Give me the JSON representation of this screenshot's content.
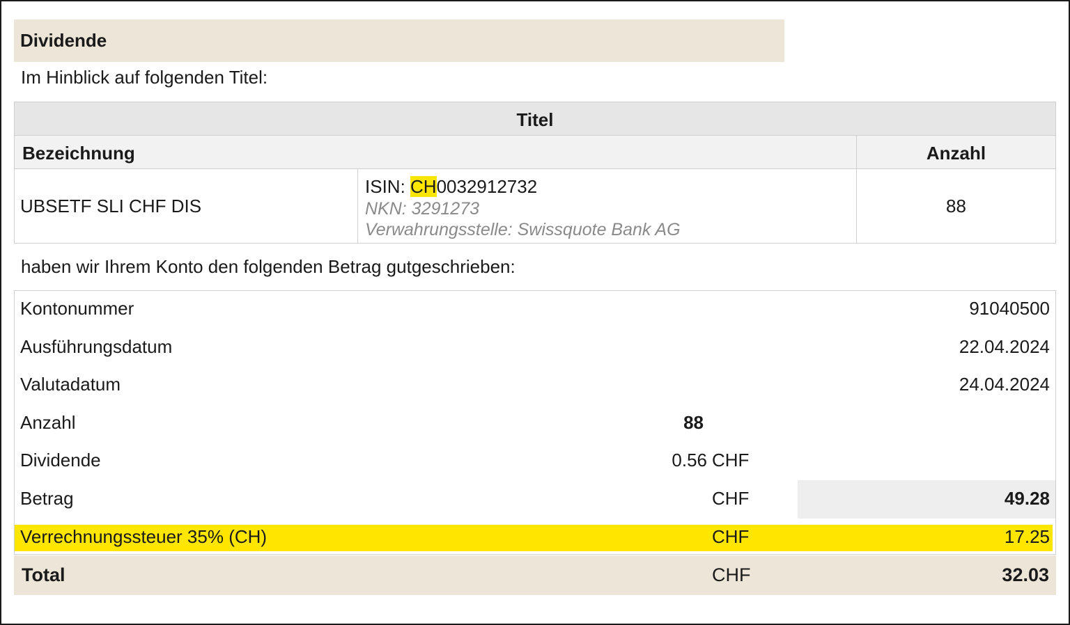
{
  "section_title": "Dividende",
  "intro_text": "Im Hinblick auf folgenden Titel:",
  "titel_table": {
    "header": "Titel",
    "col_bezeichnung": "Bezeichnung",
    "col_anzahl": "Anzahl",
    "row": {
      "name": "UBSETF SLI CHF DIS",
      "isin_label": "ISIN: ",
      "isin_country": "CH",
      "isin_number": "0032912732",
      "nkn": "NKN: 3291273",
      "verwahrungsstelle": "Verwahrungsstelle: Swissquote Bank AG",
      "anzahl": "88"
    }
  },
  "credit_text": "haben wir Ihrem Konto den folgenden Betrag gutgeschrieben:",
  "details": {
    "kontonummer": {
      "label": "Kontonummer",
      "value": "91040500"
    },
    "ausfuehrungsdatum": {
      "label": "Ausführungsdatum",
      "value": "22.04.2024"
    },
    "valutadatum": {
      "label": "Valutadatum",
      "value": "24.04.2024"
    },
    "anzahl": {
      "label": "Anzahl",
      "qty": "88"
    },
    "dividende": {
      "label": "Dividende",
      "qty": "0.56",
      "currency": "CHF"
    },
    "betrag": {
      "label": "Betrag",
      "currency": "CHF",
      "value": "49.28"
    },
    "verrechnungssteuer": {
      "label": "Verrechnungssteuer 35% (CH)",
      "currency": "CHF",
      "value": "17.25"
    },
    "total": {
      "label": "Total",
      "currency": "CHF",
      "value": "32.03"
    }
  },
  "colors": {
    "header_beige": "#ece5d8",
    "highlight_yellow": "#ffe600",
    "table_header_gray": "#e6e6e6"
  }
}
